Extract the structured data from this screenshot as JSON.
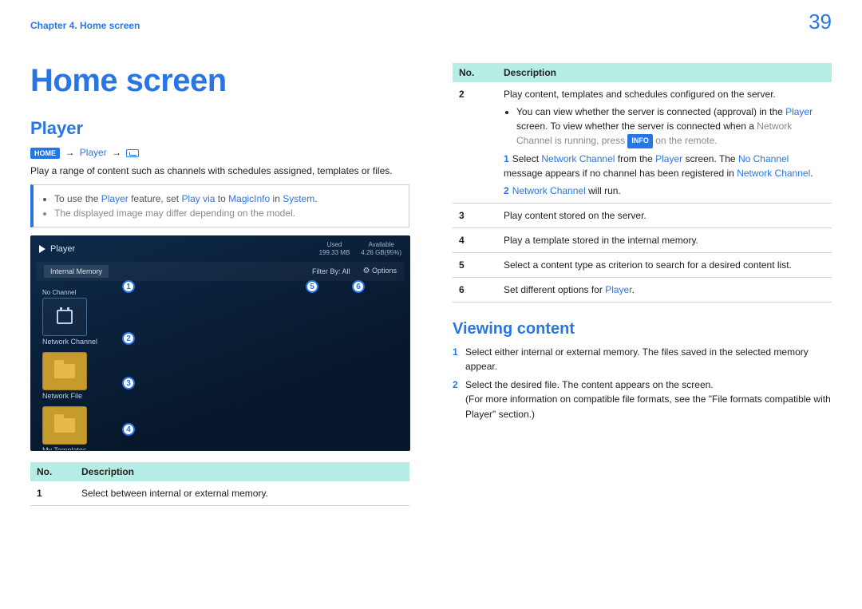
{
  "header": {
    "chapter": "Chapter 4. Home screen",
    "page_number": "39"
  },
  "title": "Home screen",
  "left": {
    "section_title": "Player",
    "breadcrumb": {
      "home_badge": "HOME",
      "arrow": "→",
      "item": "Player"
    },
    "intro": "Play a range of content such as channels with schedules assigned, templates or files.",
    "note": {
      "line1_pre": "To use the ",
      "line1_a": "Player",
      "line1_mid": " feature, set ",
      "line1_b": "Play via",
      "line1_to": " to ",
      "line1_c": "MagicInfo",
      "line1_in": " in ",
      "line1_d": "System",
      "line1_dot": ".",
      "line2": "The displayed image may differ depending on the model."
    },
    "shot": {
      "title": "Player",
      "stats": {
        "used_label": "Used",
        "used_val": "199.33 MB",
        "avail_label": "Available",
        "avail_val": "4.26 GB(95%)"
      },
      "tab_left": "Internal Memory",
      "filter_label": "Filter By: All",
      "options_label": "Options",
      "rows": {
        "r1": "No Channel",
        "r1b": "Network Channel",
        "r2": "Network File",
        "r3": "My Templates"
      },
      "markers": {
        "m1": "1",
        "m2": "2",
        "m3": "3",
        "m4": "4",
        "m5": "5",
        "m6": "6"
      }
    },
    "table": {
      "head_no": "No.",
      "head_desc": "Description",
      "r1_no": "1",
      "r1_desc": "Select between internal or external memory."
    }
  },
  "right": {
    "table": {
      "head_no": "No.",
      "head_desc": "Description",
      "r2_no": "2",
      "r2_line1": "Play content, templates and schedules configured on the server.",
      "r2_b1_pre": "You can view whether the server is connected (approval) in the ",
      "r2_b1_accent": "Player",
      "r2_b1_mid": " screen. To view whether the server is connected when a ",
      "r2_b1_mid2": "Network Channel is running, press ",
      "r2_b1_badge": "INFO",
      "r2_b1_end": " on the remote.",
      "r2_s1_num": "1",
      "r2_s1_a": "Select ",
      "r2_s1_b": "Network Channel",
      "r2_s1_c": " from the ",
      "r2_s1_d": "Player",
      "r2_s1_e": " screen. The ",
      "r2_s1_f": "No Channel",
      "r2_s1_g": " message appears if no channel has been registered in ",
      "r2_s1_h": "Network Channel",
      "r2_s1_i": ".",
      "r2_s2_num": "2",
      "r2_s2_a": "Network Channel",
      "r2_s2_b": " will run.",
      "r3_no": "3",
      "r3_desc": "Play content stored on the server.",
      "r4_no": "4",
      "r4_desc": "Play a template stored in the internal memory.",
      "r5_no": "5",
      "r5_desc": "Select a content type as criterion to search for a desired content list.",
      "r6_no": "6",
      "r6_desc_a": "Set different options for ",
      "r6_desc_b": "Player",
      "r6_desc_c": "."
    },
    "viewing_title": "Viewing content",
    "steps": {
      "s1_num": "1",
      "s1": "Select either internal or external memory. The files saved in the selected memory appear.",
      "s2_num": "2",
      "s2a": "Select the desired file. The content appears on the screen.",
      "s2b": "(For more information on compatible file formats, see the \"File formats compatible with Player\" section.)"
    }
  }
}
